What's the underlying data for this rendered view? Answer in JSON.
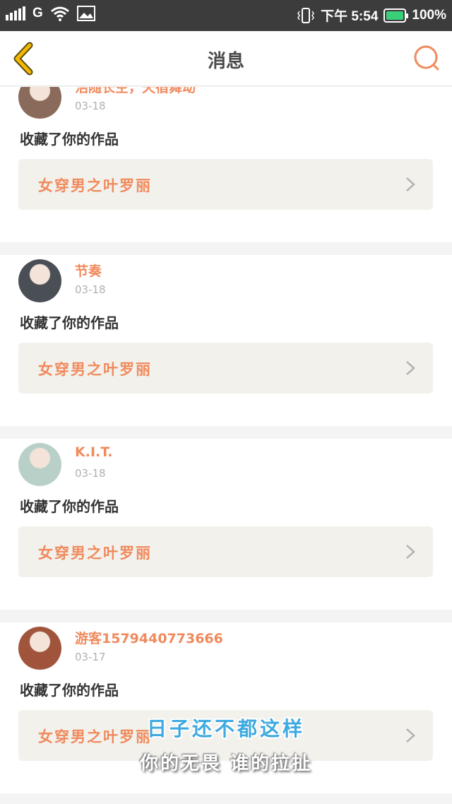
{
  "status_bar": {
    "carrier": "G",
    "time": "下午 5:54",
    "battery": "100%"
  },
  "header": {
    "title": "消息"
  },
  "messages": [
    {
      "username": "浩随长空，天宿舞动",
      "date": "03-18",
      "action": "收藏了你的作品",
      "work_title": "女穿男之叶罗丽",
      "avatar_color": "#8a6a5a"
    },
    {
      "username": "节奏",
      "date": "03-18",
      "action": "收藏了你的作品",
      "work_title": "女穿男之叶罗丽",
      "avatar_color": "#4a4f55"
    },
    {
      "username": "K.I.T.",
      "date": "03-18",
      "action": "收藏了你的作品",
      "work_title": "女穿男之叶罗丽",
      "avatar_color": "#b8d0c8"
    },
    {
      "username": "游客1579440773666",
      "date": "03-17",
      "action": "收藏了你的作品",
      "work_title": "女穿男之叶罗丽",
      "avatar_color": "#a0543c"
    }
  ],
  "subtitles": {
    "line1": "日子还不都这样",
    "line2": "你的无畏 谁的拉扯"
  },
  "colors": {
    "accent": "#f08a5d",
    "back_icon": "#f5b800",
    "card_bg": "#f3f1ec"
  }
}
